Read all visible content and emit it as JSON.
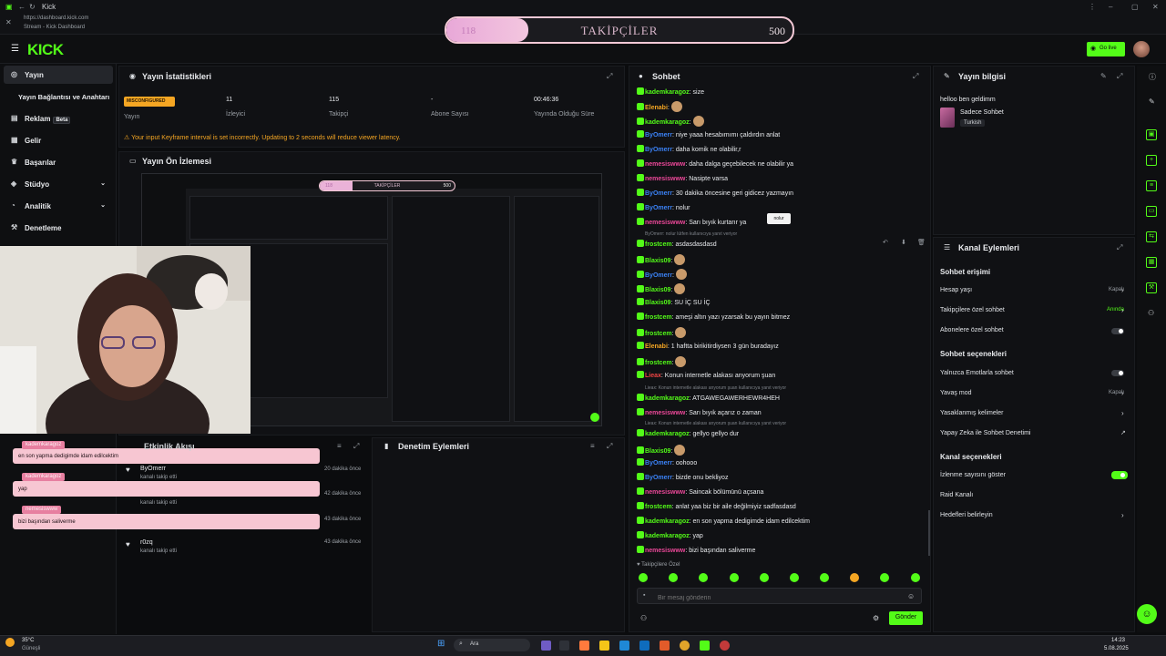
{
  "browser": {
    "tab_title": "Kick",
    "url": "https://dashboard.kick.com",
    "subtitle": "Stream - Kick Dashboard"
  },
  "goal": {
    "current": "118",
    "label": "TAKİPÇİLER",
    "max": "500",
    "progress": 0.236
  },
  "appbar": {
    "logo": "KICK",
    "go_live": "Go live"
  },
  "sidebar": {
    "items": [
      {
        "label": "Yayın",
        "icon": "broadcast-icon"
      },
      {
        "label": "Yayın Bağlantısı ve Anahtarı",
        "icon": "key-icon"
      },
      {
        "label": "Reklam",
        "badge": "Beta",
        "icon": "ad-icon"
      },
      {
        "label": "Gelir",
        "icon": "money-icon"
      },
      {
        "label": "Başarılar",
        "icon": "trophy-icon"
      },
      {
        "label": "Stüdyo",
        "icon": "studio-icon"
      },
      {
        "label": "Analitik",
        "icon": "chart-icon"
      },
      {
        "label": "Denetleme",
        "icon": "shield-icon"
      }
    ]
  },
  "stats": {
    "title": "Yayın İstatistikleri",
    "status_badge": "MISCONFIGURED",
    "items": [
      {
        "value": "",
        "label": "Yayın"
      },
      {
        "value": "11",
        "label": "İzleyici"
      },
      {
        "value": "115",
        "label": "Takipçi"
      },
      {
        "value": "-",
        "label": "Abone Sayısı"
      },
      {
        "value": "00:46:36",
        "label": "Yayında Olduğu Süre"
      }
    ],
    "warning": "Your input Keyframe interval is set incorrectly. Updating to 2 seconds will reduce viewer latency."
  },
  "preview": {
    "title": "Yayın Ön İzlemesi",
    "goal_label": "TAKİPÇİLER",
    "goal_current": "118",
    "goal_max": "500"
  },
  "overlay_messages": [
    {
      "user": "kademkaragoz",
      "text": "en son yapma dedigimde idam edilcektim"
    },
    {
      "user": "kademkaragoz",
      "text": "yap"
    },
    {
      "user": "nemesiswww",
      "text": "bizi başından saliverme"
    }
  ],
  "activity": {
    "title": "Etkinlik Akışı",
    "items": [
      {
        "name": "",
        "sub": "kanalı takip etti",
        "time": "20 dakika önce"
      },
      {
        "name": "ByOmerr",
        "sub": "kanalı takip etti",
        "time": "20 dakika önce"
      },
      {
        "name": "",
        "sub": "kanalı takip etti",
        "time": "42 dakika önce"
      },
      {
        "name": "",
        "sub": "",
        "time": "43 dakika önce"
      },
      {
        "name": "r0zq",
        "sub": "kanalı takip etti",
        "time": "43 dakika önce"
      }
    ]
  },
  "moderation": {
    "title": "Denetim Eylemleri"
  },
  "chat": {
    "title": "Sohbet",
    "messages": [
      {
        "user": "kademkaragoz",
        "text": "size",
        "color": "#53fc18"
      },
      {
        "user": "Elenabi",
        "text": "",
        "color": "#f5a623",
        "emote": true
      },
      {
        "user": "kademkaragoz",
        "text": "",
        "color": "#53fc18",
        "emote": true
      },
      {
        "user": "ByOmerr",
        "text": "niye yaaa hesabımımı çaldırdın anlat",
        "color": "#3b82f6"
      },
      {
        "user": "ByOmerr",
        "text": "daha komik ne olabilir,r",
        "color": "#3b82f6"
      },
      {
        "user": "nemesiswww",
        "text": "daha dalga geçebilecek ne olabilir ya",
        "color": "#ec4899"
      },
      {
        "user": "nemesiswww",
        "text": "Nasipte varsa",
        "color": "#ec4899"
      },
      {
        "user": "ByOmerr",
        "text": "30 dakika öncesine geri gidicez yazmayın",
        "color": "#3b82f6"
      },
      {
        "user": "ByOmerr",
        "text": "nolur",
        "color": "#3b82f6"
      },
      {
        "user": "nemesiswww",
        "text": "Sarı bıyık kurtarır ya",
        "color": "#ec4899"
      },
      {
        "user": "frostcem",
        "text": "asdasdasdasd",
        "color": "#53fc18",
        "reply": "ByOmerr: nolur lütfen kullanıcıya yanıt veriyor"
      },
      {
        "user": "Blaxis09",
        "text": "",
        "color": "#53fc18",
        "emote": true
      },
      {
        "user": "ByOmerr",
        "text": "",
        "color": "#3b82f6",
        "emote": true
      },
      {
        "user": "Blaxis09",
        "text": "",
        "color": "#53fc18",
        "emote": true
      },
      {
        "user": "Blaxis09",
        "text": "SU İÇ  SU İÇ",
        "color": "#53fc18"
      },
      {
        "user": "frostcem",
        "text": "ameşi altın yazı yzarsak bu yayın bitmez",
        "color": "#53fc18"
      },
      {
        "user": "frostcem",
        "text": "",
        "color": "#53fc18",
        "emote": true
      },
      {
        "user": "Elenabi",
        "text": "1 haftta birikitirdiysen 3 gün buradayız",
        "color": "#f5a623"
      },
      {
        "user": "frostcem",
        "text": "",
        "color": "#53fc18",
        "emote": true
      },
      {
        "user": "Lieax",
        "text": "Konun internetle alakası anyorum şuan",
        "color": "#ef4444"
      },
      {
        "user": "kademkaragoz",
        "text": "ATGAWEGAWERHEWR4HEH",
        "color": "#53fc18",
        "reply": "Lieax: Konun internetle alakası anyorum şuan kullanıcıya yanıt veriyor"
      },
      {
        "user": "nemesiswww",
        "text": "Sarı bıyık açarız o zaman",
        "color": "#ec4899"
      },
      {
        "user": "kademkaragoz",
        "text": "gellyo gellyo dur",
        "color": "#53fc18",
        "reply": "Lieax: Konun internetle alakası anyorum şuan kullanıcıya yanıt veriyor"
      },
      {
        "user": "Blaxis09",
        "text": "",
        "color": "#53fc18",
        "emote": true
      },
      {
        "user": "ByOmerr",
        "text": "oohooo",
        "color": "#3b82f6"
      },
      {
        "user": "ByOmerr",
        "text": "bizde onu bekliyoz",
        "color": "#3b82f6"
      },
      {
        "user": "nemesiswww",
        "text": "Saincak bölümünü açsana",
        "color": "#ec4899"
      },
      {
        "user": "frostcem",
        "text": "anlat yaa biz bir aile değilmiyiz sadfasdasd",
        "color": "#53fc18"
      },
      {
        "user": "kademkaragoz",
        "text": "en son yapma dedigimde idam edilcektim",
        "color": "#53fc18"
      },
      {
        "user": "kademkaragoz",
        "text": "yap",
        "color": "#53fc18"
      },
      {
        "user": "nemesiswww",
        "text": "bizi başından saliverme",
        "color": "#ec4899"
      }
    ],
    "tooltip": "nolur",
    "followers_only": "Takipçilere Özel",
    "input_placeholder": "Bir mesaj gönderin",
    "send_label": "Gönder"
  },
  "stream_info": {
    "title": "Yayın bilgisi",
    "stream_title": "helloo ben geldimm",
    "category": "Sadece Sohbet",
    "language": "Turkish"
  },
  "channel_actions": {
    "title": "Kanal Eylemleri",
    "chat_access_heading": "Sohbet erişimi",
    "chat_access": [
      {
        "label": "Hesap yaşı",
        "value": "Kapalı",
        "type": "select"
      },
      {
        "label": "Takipçilere özel sohbet",
        "value": "Anında",
        "type": "select",
        "accent": true
      },
      {
        "label": "Abonelere özel sohbet",
        "value": "",
        "type": "toggle",
        "on": false
      }
    ],
    "chat_options_heading": "Sohbet seçenekleri",
    "chat_options": [
      {
        "label": "Yalnızca Emotlarla sohbet",
        "value": "",
        "type": "toggle",
        "on": false
      },
      {
        "label": "Yavaş mod",
        "value": "Kapalı",
        "type": "select"
      },
      {
        "label": "Yasaklanmış kelimeler",
        "value": "",
        "type": "link"
      },
      {
        "label": "Yapay Zeka ile Sohbet Denetimi",
        "value": "",
        "type": "external"
      }
    ],
    "channel_options_heading": "Kanal seçenekleri",
    "channel_options": [
      {
        "label": "İzlenme sayısını göster",
        "value": "",
        "type": "toggle",
        "on": true
      },
      {
        "label": "Raid Kanalı",
        "value": "",
        "type": "none"
      },
      {
        "label": "Hedefleri belirleyin",
        "value": "",
        "type": "link"
      }
    ]
  },
  "taskbar": {
    "weather_temp": "35°C",
    "weather_desc": "Güneşli",
    "search": "Ara",
    "time": "14:23",
    "date": "5.08.2025"
  },
  "colors": {
    "accent": "#53fc18",
    "warning": "#f5a623",
    "goal_pink": "#f4c9d6",
    "chat_pink": "#f7c6d2"
  }
}
